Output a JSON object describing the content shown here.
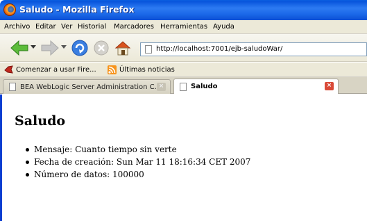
{
  "window": {
    "title": "Saludo - Mozilla Firefox"
  },
  "menu": [
    "Archivo",
    "Editar",
    "Ver",
    "Historial",
    "Marcadores",
    "Herramientas",
    "Ayuda"
  ],
  "nav": {
    "url": "http://localhost:7001/ejb-saludoWar/"
  },
  "bookmarks": [
    "Comenzar a usar Fire...",
    "Últimas noticias"
  ],
  "tabs": [
    {
      "label": "BEA WebLogic Server Administration C...",
      "active": false
    },
    {
      "label": "Saludo",
      "active": true
    }
  ],
  "page": {
    "heading": "Saludo",
    "items": [
      "Mensaje: Cuanto tiempo sin verte",
      "Fecha de creación: Sun Mar 11 18:16:34 CET 2007",
      "Número de datos: 100000"
    ]
  },
  "colors": {
    "titlebar": "#1b68e8",
    "chrome": "#ece9d8",
    "tab_close_active": "#d94a38"
  }
}
